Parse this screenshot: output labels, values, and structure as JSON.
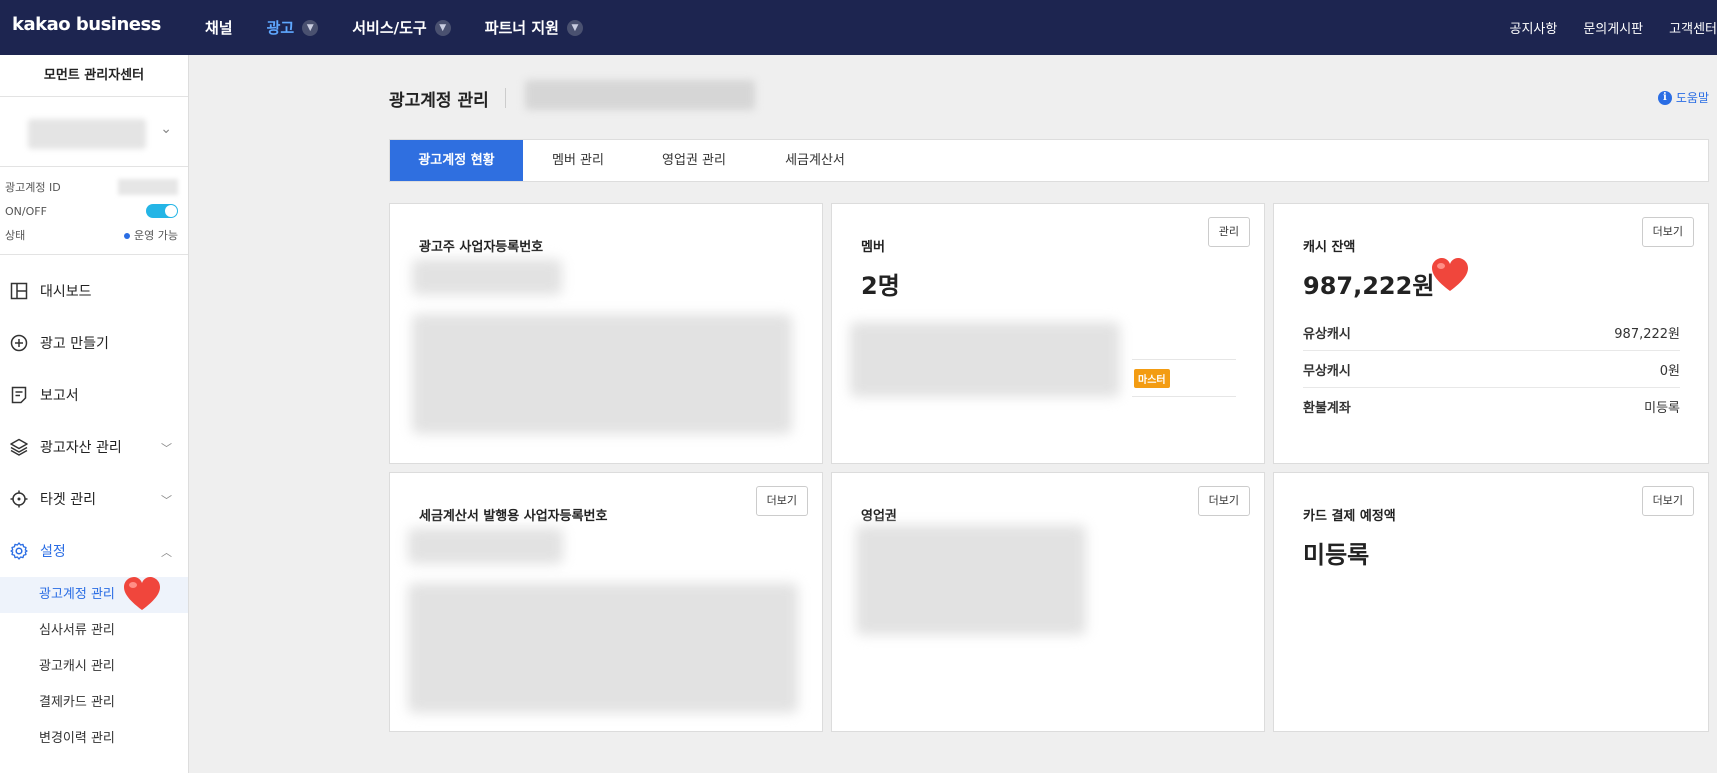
{
  "header": {
    "logo": "kakao business",
    "nav": [
      {
        "label": "채널",
        "has_dropdown": false,
        "active": false
      },
      {
        "label": "광고",
        "has_dropdown": true,
        "active": true
      },
      {
        "label": "서비스/도구",
        "has_dropdown": true,
        "active": false
      },
      {
        "label": "파트너 지원",
        "has_dropdown": true,
        "active": false
      }
    ],
    "right_links": [
      "공지사항",
      "문의게시판",
      "고객센터"
    ]
  },
  "sidebar": {
    "title": "모먼트 관리자센터",
    "account_info": {
      "id_label": "광고계정 ID",
      "onoff_label": "ON/OFF",
      "status_label": "상태",
      "status_value": "운영 가능"
    },
    "menu": [
      {
        "label": "대시보드",
        "icon": "dashboard-icon",
        "expandable": false
      },
      {
        "label": "광고 만들기",
        "icon": "plus-circle-icon",
        "expandable": false
      },
      {
        "label": "보고서",
        "icon": "report-icon",
        "expandable": false
      },
      {
        "label": "광고자산 관리",
        "icon": "layers-icon",
        "expandable": true
      },
      {
        "label": "타겟 관리",
        "icon": "target-icon",
        "expandable": true
      },
      {
        "label": "설정",
        "icon": "gear-icon",
        "expandable": true,
        "expanded": true
      }
    ],
    "submenu": [
      {
        "label": "광고계정 관리",
        "active": true
      },
      {
        "label": "심사서류 관리",
        "active": false
      },
      {
        "label": "광고캐시 관리",
        "active": false
      },
      {
        "label": "결제카드 관리",
        "active": false
      },
      {
        "label": "변경이력 관리",
        "active": false
      }
    ]
  },
  "main": {
    "title": "광고계정 관리",
    "help_label": "도움말",
    "tabs": [
      "광고계정 현황",
      "멤버 관리",
      "영업권 관리",
      "세금계산서"
    ],
    "active_tab": 0,
    "cards": {
      "biz_reg": {
        "label": "광고주 사업자등록번호"
      },
      "member": {
        "label": "멤버",
        "button": "관리",
        "value": "2명",
        "badge": "마스터"
      },
      "cash": {
        "label": "캐시 잔액",
        "button": "더보기",
        "value": "987,222원",
        "rows": [
          {
            "label": "유상캐시",
            "value": "987,222원"
          },
          {
            "label": "무상캐시",
            "value": "0원"
          },
          {
            "label": "환불계좌",
            "value": "미등록"
          }
        ]
      },
      "tax_biz": {
        "label": "세금계산서 발행용 사업자등록번호",
        "button": "더보기"
      },
      "sales_right": {
        "label": "영업권",
        "button": "더보기"
      },
      "card_payment": {
        "label": "카드 결제 예정액",
        "button": "더보기",
        "value": "미등록"
      }
    }
  },
  "colors": {
    "topbar": "#1d2550",
    "accent": "#2f6fe0",
    "toggle_on": "#24b5e6",
    "badge": "#f39c12",
    "heart": "#f0463c"
  }
}
